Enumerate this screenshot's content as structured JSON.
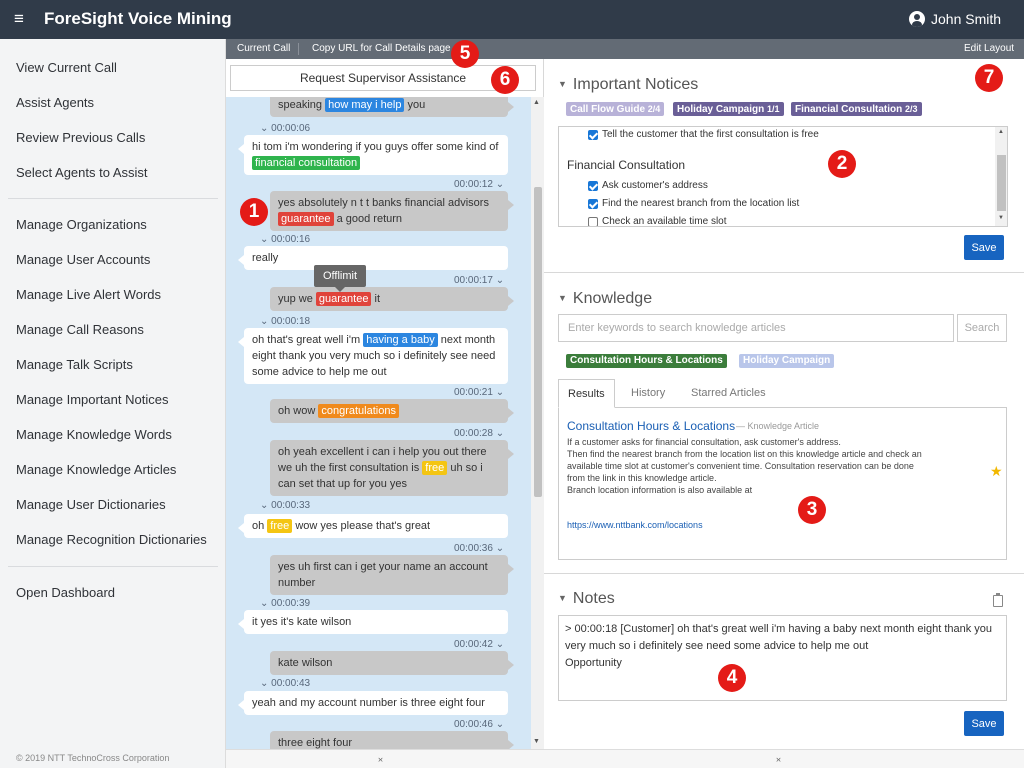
{
  "app": {
    "title": "ForeSight Voice Mining",
    "menu_icon": "≡",
    "user_name": "John Smith"
  },
  "sidebar": {
    "items": [
      "View Current Call",
      "Assist Agents",
      "Review Previous Calls",
      "Select Agents to Assist",
      "Manage Organizations",
      "Manage User Accounts",
      "Manage Live Alert Words",
      "Manage Call Reasons",
      "Manage Talk Scripts",
      "Manage Important Notices",
      "Manage Knowledge Words",
      "Manage Knowledge Articles",
      "Manage User Dictionaries",
      "Manage Recognition Dictionaries",
      "Open Dashboard"
    ],
    "copyright": "© 2019 NTT TechnoCross Corporation"
  },
  "subbar": {
    "current_call": "Current Call",
    "copy_url": "Copy URL for Call Details page",
    "edit_layout": "Edit Layout"
  },
  "chat": {
    "supervisor_button": "Request Supervisor Assistance",
    "tooltip": "Offlimit",
    "collapse_icon": "›‹",
    "timestamp_caret": "⌄",
    "bubbles": [
      {
        "side": "right",
        "parts": [
          {
            "t": "speaking "
          },
          {
            "t": "how may i help",
            "hl": "blue"
          },
          {
            "t": " you"
          }
        ]
      },
      {
        "side": "left",
        "parts": [
          {
            "t": "hi tom i'm wondering if you guys offer some kind of "
          },
          {
            "t": "financial consultation",
            "hl": "green"
          }
        ]
      },
      {
        "side": "right",
        "parts": [
          {
            "t": "yes absolutely n t t banks financial advisors "
          },
          {
            "t": "guarantee",
            "hl": "red"
          },
          {
            "t": " a good return"
          }
        ]
      },
      {
        "side": "left",
        "parts": [
          {
            "t": "really"
          }
        ]
      },
      {
        "side": "right",
        "parts": [
          {
            "t": "yup we "
          },
          {
            "t": "guarantee",
            "hl": "red"
          },
          {
            "t": " it"
          }
        ]
      },
      {
        "side": "left",
        "parts": [
          {
            "t": "oh that's great well i'm "
          },
          {
            "t": "having a baby",
            "hl": "blue"
          },
          {
            "t": " next month eight thank you very much so i definitely see need some advice to help me out"
          }
        ]
      },
      {
        "side": "right",
        "parts": [
          {
            "t": "oh wow "
          },
          {
            "t": "congratulations",
            "hl": "orange"
          }
        ]
      },
      {
        "side": "right",
        "parts": [
          {
            "t": "oh yeah excellent i can i help you out there we uh the first consultation is "
          },
          {
            "t": "free",
            "hl": "yellow"
          },
          {
            "t": " uh so i can set that up for you yes"
          }
        ]
      },
      {
        "side": "left",
        "parts": [
          {
            "t": "oh "
          },
          {
            "t": "free",
            "hl": "yellow"
          },
          {
            "t": " wow yes please that's great"
          }
        ]
      },
      {
        "side": "right",
        "parts": [
          {
            "t": "yes uh first can i get your name an account number"
          }
        ]
      },
      {
        "side": "left",
        "parts": [
          {
            "t": "it yes it's kate wilson"
          }
        ]
      },
      {
        "side": "right",
        "parts": [
          {
            "t": "kate wilson"
          }
        ]
      },
      {
        "side": "left",
        "parts": [
          {
            "t": "yeah and my account number is three eight four"
          }
        ]
      },
      {
        "side": "right",
        "parts": [
          {
            "t": "three eight four"
          }
        ]
      }
    ],
    "timestamps": [
      "00:00:06",
      "00:00:12",
      "00:00:16",
      "00:00:17",
      "00:00:18",
      "00:00:21",
      "00:00:28",
      "00:00:33",
      "00:00:36",
      "00:00:39",
      "00:00:42",
      "00:00:43",
      "00:00:46"
    ]
  },
  "notices": {
    "title": "Important Notices",
    "tags": [
      {
        "label": "Call Flow Guide",
        "count": "2/4"
      },
      {
        "label": "Holiday Campaign",
        "count": "1/1"
      },
      {
        "label": "Financial Consultation",
        "count": "2/3"
      }
    ],
    "top_item": "Tell the customer that the first consultation is free",
    "group_title": "Financial Consultation",
    "items": [
      {
        "label": "Ask customer's address",
        "checked": true
      },
      {
        "label": "Find the nearest branch from the location list",
        "checked": true
      },
      {
        "label": "Check an available time slot",
        "checked": false
      }
    ],
    "save": "Save"
  },
  "knowledge": {
    "title": "Knowledge",
    "search_placeholder": "Enter keywords to search knowledge articles",
    "search_button": "Search",
    "tags": [
      "Consultation Hours & Locations",
      "Holiday Campaign"
    ],
    "tabs": [
      "Results",
      "History",
      "Starred Articles"
    ],
    "article": {
      "title": "Consultation Hours & Locations",
      "type": "— Knowledge Article",
      "body_lines": [
        "If a customer asks for financial consultation, ask customer's address.",
        "Then find the nearest branch from the location list on this knowledge article and check an",
        "available time slot at customer's convenient time. Consultation reservation can be done",
        "from the link in this knowledge article.",
        "Branch location information is also available at"
      ],
      "link": "https://www.nttbank.com/locations",
      "star": "★"
    }
  },
  "notes": {
    "title": "Notes",
    "text": "> 00:00:18 [Customer] oh that's great well i'm having a baby next month eight thank you very much so i definitely see need some advice to help me out\nOpportunity",
    "save": "Save"
  },
  "markers": [
    "1",
    "2",
    "3",
    "4",
    "5",
    "6",
    "7"
  ],
  "colors": {
    "topbar": "#303b49",
    "chat_bg": "#d4e7f6",
    "save_button": "#1764c0",
    "marker": "#e41b17"
  }
}
